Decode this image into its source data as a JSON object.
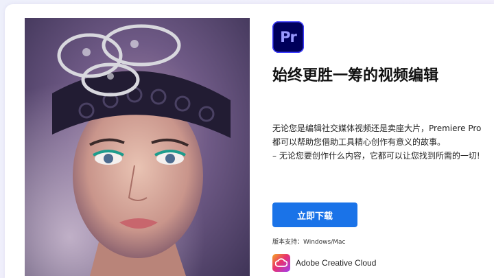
{
  "product": {
    "icon_text": "Pr",
    "icon_name": "premiere-pro-icon",
    "title": "始终更胜一筹的视频编辑"
  },
  "description": {
    "line1": "无论您是编辑社交媒体视频还是卖座大片，Premiere Pro 都可以帮助您借助工具精心创作有意义的故事。",
    "line2": "– 无论您要创作什么内容，它都可以让您找到所需的一切!"
  },
  "download_button": {
    "label": "立即下载"
  },
  "support": {
    "text": "版本支持：Windows/Mac"
  },
  "suite": {
    "label": "Adobe Creative Cloud",
    "icon_name": "creative-cloud-icon"
  },
  "colors": {
    "accent": "#1a73e8",
    "premiere_bg": "#00005b",
    "premiere_text": "#9999ff"
  }
}
